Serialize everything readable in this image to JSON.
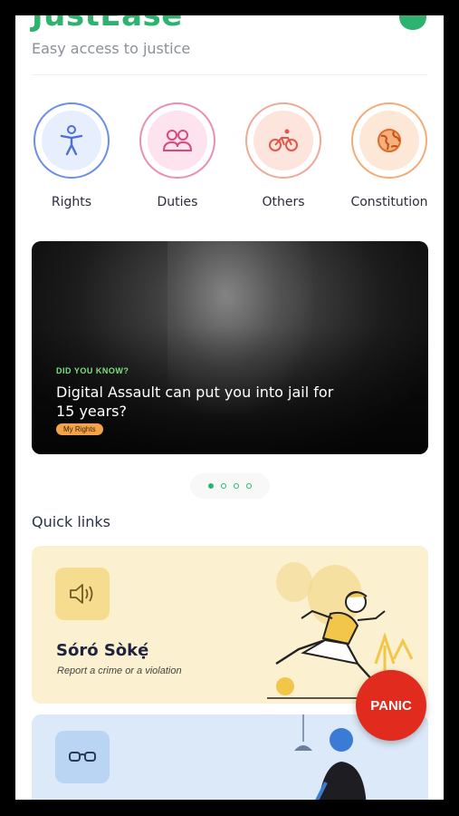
{
  "app": {
    "name": "JustEase",
    "tagline": "Easy access to justice"
  },
  "categories": [
    {
      "label": "Rights",
      "icon": "person-icon",
      "ring": "#6b8ee8",
      "fill": "#e7efff"
    },
    {
      "label": "Duties",
      "icon": "people-icon",
      "ring": "#ea8fb3",
      "fill": "#fde3ee"
    },
    {
      "label": "Others",
      "icon": "bicycle-icon",
      "ring": "#f0a995",
      "fill": "#fde4dc"
    },
    {
      "label": "Constitution",
      "icon": "globe-icon",
      "ring": "#f4ab78",
      "fill": "#fde8d8"
    }
  ],
  "banner": {
    "kicker": "DID YOU KNOW?",
    "headline": "Digital Assault can put you into jail for 15 years?",
    "tag": "My Rights"
  },
  "carousel": {
    "total": 4,
    "active": 1
  },
  "quick_links": {
    "title": "Quick links",
    "cards": [
      {
        "title": "Sóró Sòkẹ́",
        "subtitle": "Report a crime or a violation",
        "icon": "speaker-icon"
      },
      {
        "title": "",
        "subtitle": "",
        "icon": "glasses-icon"
      }
    ]
  },
  "panic_button": {
    "label": "PANIC"
  },
  "colors": {
    "brand": "#2db36f",
    "panic": "#e02b1e",
    "tag": "#f4a347"
  }
}
